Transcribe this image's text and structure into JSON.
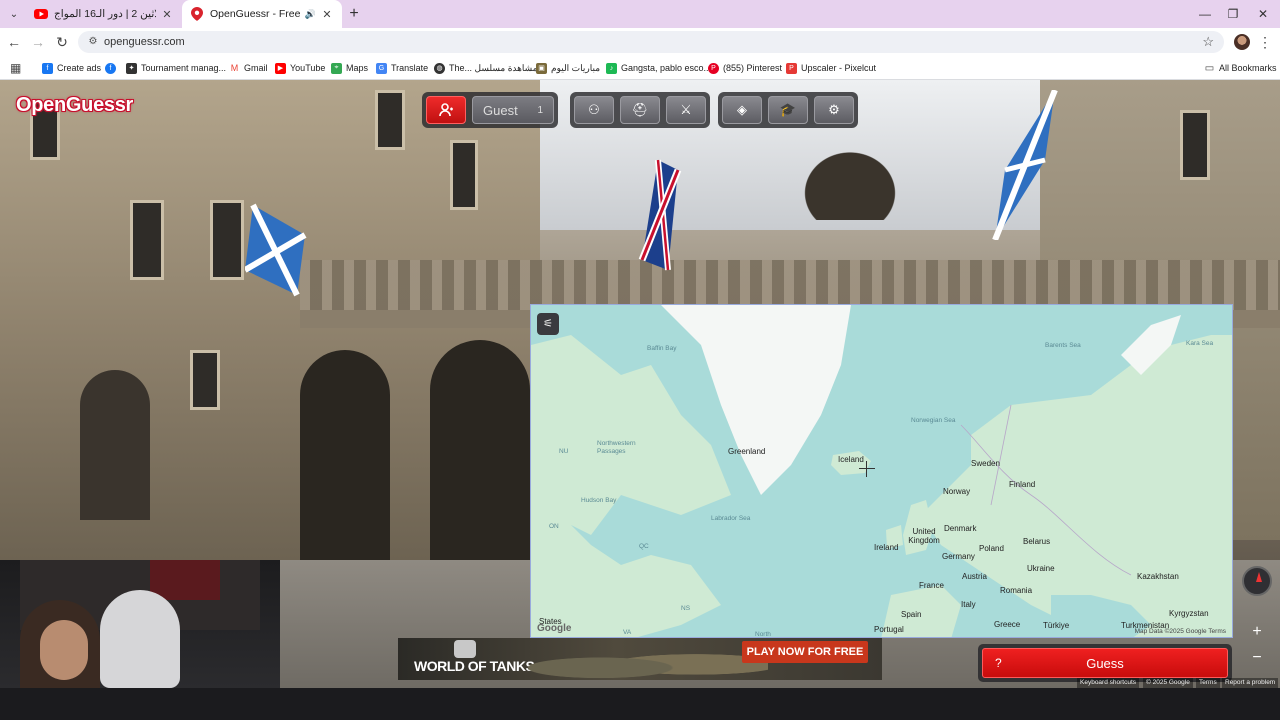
{
  "tabs": [
    {
      "title": "تحدي الثلاثين 2 | دور الـ16 المواج...",
      "active": false,
      "icon": "youtube-icon"
    },
    {
      "title": "OpenGuessr - Free GeoGue",
      "active": true,
      "icon": "pin-icon"
    }
  ],
  "address_bar": {
    "url": "openguessr.com"
  },
  "bookmarks": [
    {
      "label": "Create ads",
      "icon": "facebook-icon",
      "color": "#1877f2"
    },
    {
      "label": "",
      "icon": "facebook-icon",
      "color": "#1877f2"
    },
    {
      "label": "Tournament manag...",
      "icon": "bird-icon",
      "color": "#333333"
    },
    {
      "label": "Gmail",
      "icon": "gmail-icon",
      "color": "#ea4335"
    },
    {
      "label": "YouTube",
      "icon": "youtube-icon",
      "color": "#ff0000"
    },
    {
      "label": "Maps",
      "icon": "maps-icon",
      "color": "#34a853"
    },
    {
      "label": "Translate",
      "icon": "translate-icon",
      "color": "#4285f4"
    },
    {
      "label": "The... مشاهدة مسلسل",
      "icon": "globe-icon",
      "color": "#333333"
    },
    {
      "label": "مباريات اليوم",
      "icon": "site-icon",
      "color": "#7a6a3a"
    },
    {
      "label": "Gangsta, pablo esco...",
      "icon": "sound-icon",
      "color": "#1db954"
    },
    {
      "label": "(855) Pinterest",
      "icon": "pinterest-icon",
      "color": "#e60023"
    },
    {
      "label": "Upscaler - Pixelcut",
      "icon": "pixelcut-icon",
      "color": "#e53935"
    }
  ],
  "all_bookmarks": "All Bookmarks",
  "game": {
    "logo": "OpenGuessr",
    "player": {
      "name": "Guest",
      "count": "1"
    },
    "guess_label": "Guess",
    "guess_hint": "?"
  },
  "map_labels": {
    "seas": [
      {
        "name": "Baffin Bay"
      },
      {
        "name": "Barents Sea"
      },
      {
        "name": "Kara Sea"
      },
      {
        "name": "Norwegian Sea"
      },
      {
        "name": "Northwestern Passages"
      },
      {
        "name": "Labrador Sea"
      },
      {
        "name": "Hudson Bay"
      },
      {
        "name": "North"
      }
    ],
    "countries": [
      {
        "name": "Greenland"
      },
      {
        "name": "Iceland"
      },
      {
        "name": "Sweden"
      },
      {
        "name": "Finland"
      },
      {
        "name": "Norway"
      },
      {
        "name": "Denmark"
      },
      {
        "name": "United Kingdom"
      },
      {
        "name": "Ireland"
      },
      {
        "name": "Belarus"
      },
      {
        "name": "Poland"
      },
      {
        "name": "Germany"
      },
      {
        "name": "Ukraine"
      },
      {
        "name": "Kazakhstan"
      },
      {
        "name": "France"
      },
      {
        "name": "Austria"
      },
      {
        "name": "Romania"
      },
      {
        "name": "Italy"
      },
      {
        "name": "Spain"
      },
      {
        "name": "Greece"
      },
      {
        "name": "Türkiye"
      },
      {
        "name": "Turkmenistan"
      },
      {
        "name": "Kyrgyzstan"
      },
      {
        "name": "Portugal"
      },
      {
        "name": "States"
      },
      {
        "name": "NU"
      },
      {
        "name": "ON"
      },
      {
        "name": "QC"
      },
      {
        "name": "NS"
      },
      {
        "name": "VA"
      }
    ],
    "google": "Google",
    "attribution": "Map Data ©2025 Google   Terms"
  },
  "ad": {
    "brand": "WORLD OF TANKS",
    "cta": "PLAY NOW FOR FREE"
  },
  "footer": {
    "shortcuts": "Keyboard shortcuts",
    "copyright": "© 2025 Google",
    "terms": "Terms",
    "report": "Report a problem"
  },
  "colors": {
    "accent": "#e81c1c",
    "map_water": "#a9dbd9",
    "map_land": "#cfead4",
    "tabbar": "#e7d2ee"
  }
}
